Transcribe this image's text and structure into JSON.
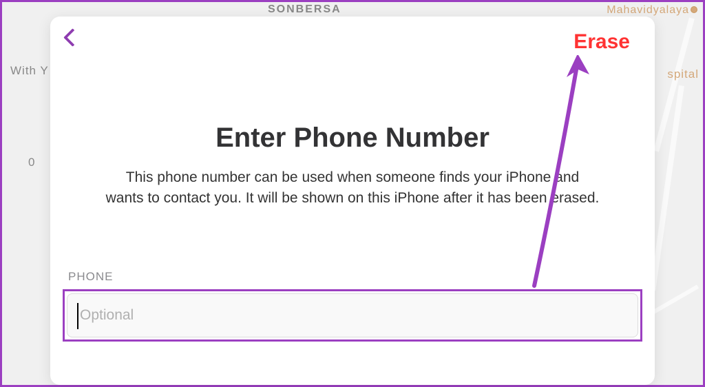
{
  "background": {
    "map_labels": {
      "sonbersa": "SONBERSA",
      "mahavidyalaya": "Mahavidyalaya",
      "with_y": "With Y",
      "spital": "spital",
      "zero": "0"
    }
  },
  "modal": {
    "action_label": "Erase",
    "title": "Enter Phone Number",
    "description": "This phone number can be used when someone finds your iPhone and wants to contact you. It will be shown on this iPhone after it has been erased.",
    "phone": {
      "label": "PHONE",
      "placeholder": "Optional",
      "value": ""
    }
  },
  "annotations": {
    "arrow_color": "#9b3fc1",
    "highlight_color": "#9b3fc1"
  }
}
